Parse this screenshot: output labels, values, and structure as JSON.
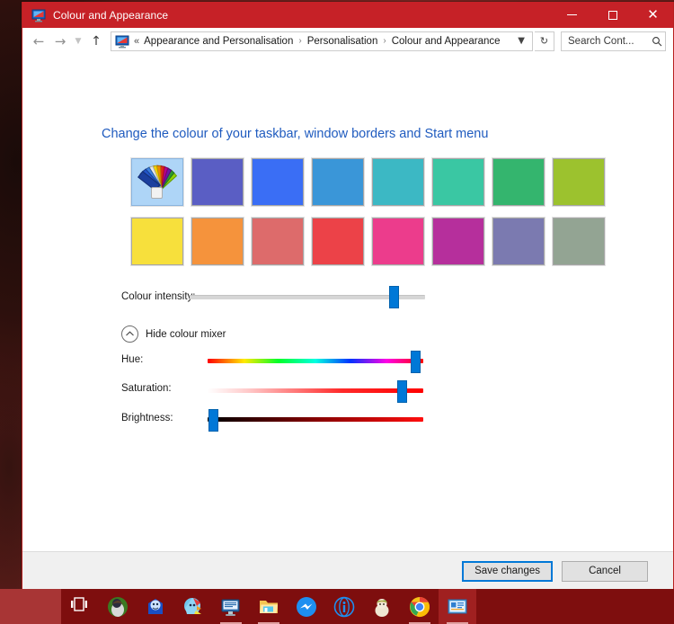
{
  "window": {
    "title": "Colour and Appearance",
    "title_icon": "display-monitor-icon",
    "accent_color": "#c62127",
    "controls": {
      "minimize": "minimize-icon",
      "maximize": "maximize-icon",
      "close": "close-icon"
    }
  },
  "addressbar": {
    "back": "back-arrow-icon",
    "forward": "forward-arrow-icon",
    "recent": "chevron-down-icon",
    "up": "up-arrow-icon",
    "crumb_icon": "display-monitor-icon",
    "overflow": "«",
    "breadcrumbs": [
      "Appearance and Personalisation",
      "Personalisation",
      "Colour and Appearance"
    ],
    "separator": "›",
    "dropdown": "chevron-down-icon",
    "refresh": "refresh-icon",
    "search": {
      "value": "Search Cont...",
      "placeholder": "Search Control Panel",
      "icon": "search-icon"
    }
  },
  "main": {
    "heading": "Change the colour of your taskbar, window borders and Start menu",
    "swatches": [
      {
        "name": "custom-colour-picker",
        "color": "#aed5f7",
        "selected": true,
        "icon": "colour-fan-icon"
      },
      {
        "name": "swatch-indigo",
        "color": "#5a5ec4",
        "selected": false
      },
      {
        "name": "swatch-blue",
        "color": "#3a6ef5",
        "selected": false
      },
      {
        "name": "swatch-azure",
        "color": "#3a96d8",
        "selected": false
      },
      {
        "name": "swatch-teal",
        "color": "#3cb8c4",
        "selected": false
      },
      {
        "name": "swatch-aquamarine",
        "color": "#3ac7a3",
        "selected": false
      },
      {
        "name": "swatch-green",
        "color": "#34b56e",
        "selected": false
      },
      {
        "name": "swatch-lime",
        "color": "#9cc22e",
        "selected": false
      },
      {
        "name": "swatch-yellow",
        "color": "#f7e03c",
        "selected": false
      },
      {
        "name": "swatch-orange",
        "color": "#f5933c",
        "selected": false
      },
      {
        "name": "swatch-salmon",
        "color": "#dd6b6b",
        "selected": false
      },
      {
        "name": "swatch-red",
        "color": "#ec4248",
        "selected": false
      },
      {
        "name": "swatch-pink",
        "color": "#ec3c8c",
        "selected": false
      },
      {
        "name": "swatch-magenta",
        "color": "#b62f9c",
        "selected": false
      },
      {
        "name": "swatch-purple-grey",
        "color": "#7b7ab0",
        "selected": false
      },
      {
        "name": "swatch-sage",
        "color": "#93a493",
        "selected": false
      }
    ],
    "intensity": {
      "label": "Colour intensity:",
      "value_percent": 85
    },
    "mixer_toggle": {
      "label": "Hide colour mixer",
      "icon": "chevron-up-circle-icon",
      "expanded": true
    },
    "mixer": [
      {
        "name": "hue-slider",
        "label": "Hue:",
        "value_percent": 95
      },
      {
        "name": "saturation-slider",
        "label": "Saturation:",
        "value_percent": 88
      },
      {
        "name": "brightness-slider",
        "label": "Brightness:",
        "value_percent": 2
      }
    ]
  },
  "footer": {
    "save_label": "Save changes",
    "cancel_label": "Cancel"
  },
  "taskbar": {
    "background": "#7e0e0e",
    "items": [
      {
        "name": "task-view-icon",
        "running": false,
        "active": false
      },
      {
        "name": "app-avatar-green-icon",
        "running": false,
        "active": false
      },
      {
        "name": "app-avatar-blue-icon",
        "running": false,
        "active": false
      },
      {
        "name": "app-avatar-rainbow-icon",
        "running": false,
        "active": false
      },
      {
        "name": "remote-desktop-icon",
        "running": true,
        "active": false
      },
      {
        "name": "file-explorer-icon",
        "running": true,
        "active": false
      },
      {
        "name": "messenger-icon",
        "running": false,
        "active": false
      },
      {
        "name": "info-circle-icon",
        "running": false,
        "active": false
      },
      {
        "name": "app-avatar-pale-icon",
        "running": false,
        "active": false
      },
      {
        "name": "chrome-icon",
        "running": true,
        "active": false
      },
      {
        "name": "control-panel-icon",
        "running": true,
        "active": true
      }
    ]
  }
}
